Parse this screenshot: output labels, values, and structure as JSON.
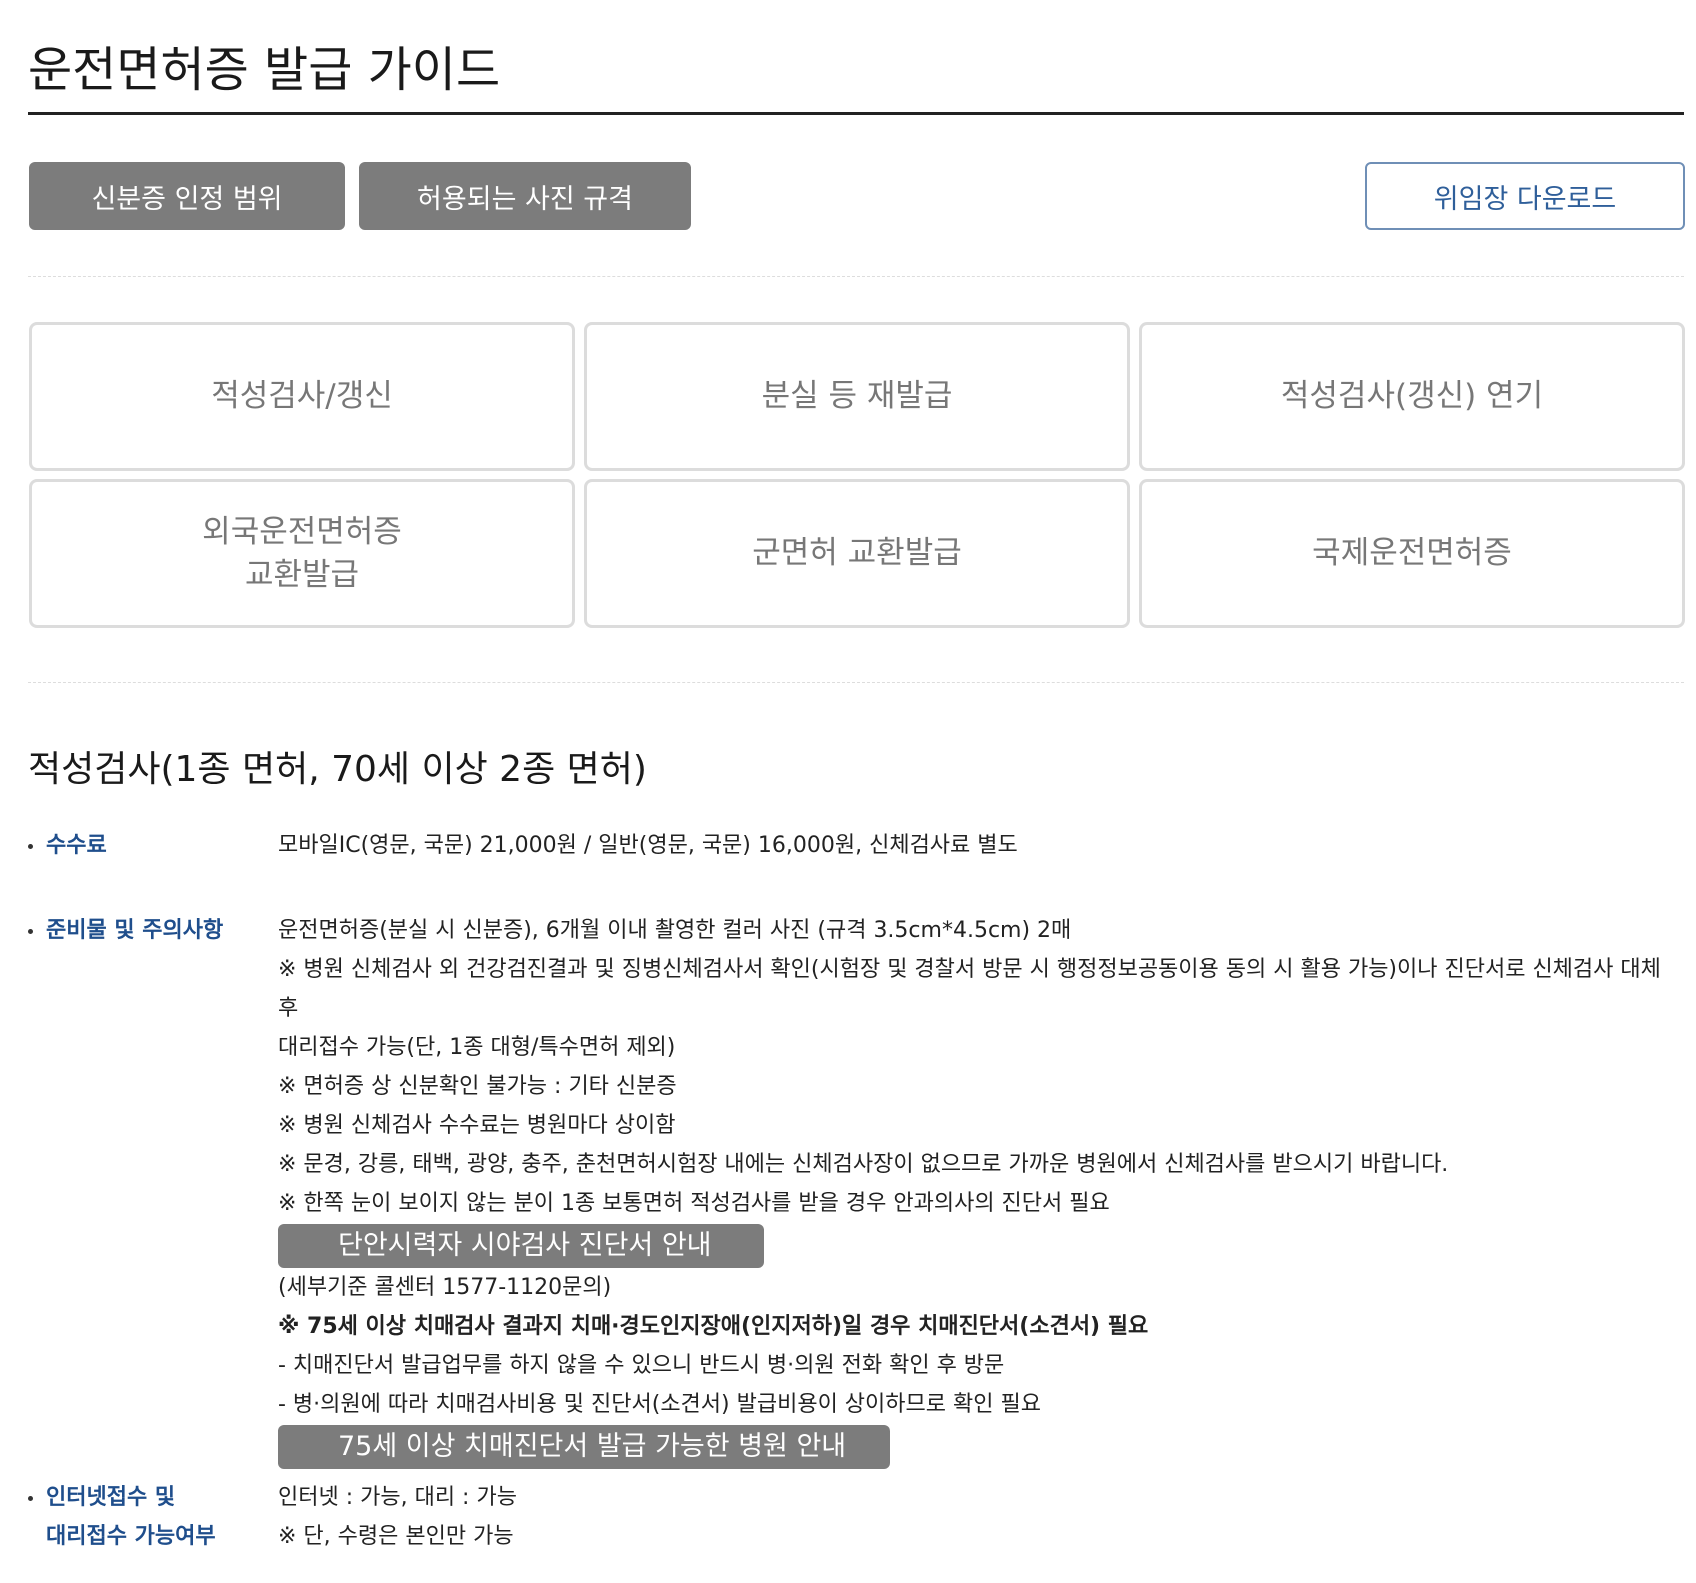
{
  "page_title": "운전면허증 발급 가이드",
  "top_buttons": {
    "id_scope": "신분증 인정 범위",
    "photo_spec": "허용되는 사진 규격",
    "proxy_download": "위임장 다운로드"
  },
  "tiles": [
    "적성검사/갱신",
    "분실 등 재발급",
    "적성검사(갱신) 연기",
    "외국운전면허증\n교환발급",
    "군면허 교환발급",
    "국제운전면허증"
  ],
  "section_title": "적성검사(1종 면허, 70세 이상 2종 면허)",
  "fee": {
    "label": "수수료",
    "value": "모바일IC(영문, 국문) 21,000원 / 일반(영문, 국문) 16,000원, 신체검사료 별도"
  },
  "prep": {
    "label": "준비물 및 주의사항",
    "lines": [
      "운전면허증(분실 시 신분증), 6개월 이내 촬영한 컬러 사진 (규격 3.5cm*4.5cm) 2매",
      "※ 병원 신체검사 외 건강검진결과 및 징병신체검사서 확인(시험장 및 경찰서 방문 시 행정정보공동이용 동의 시 활용 가능)이나 진단서로 신체검사 대체 후",
      "대리접수 가능(단, 1종 대형/특수면허 제외)",
      "※ 면허증 상 신분확인 불가능 : 기타 신분증",
      "※ 병원 신체검사 수수료는 병원마다 상이함",
      "※ 문경, 강릉, 태백, 광양, 충주, 춘천면허시험장 내에는 신체검사장이 없으므로 가까운 병원에서 신체검사를 받으시기 바랍니다.",
      "※ 한쪽 눈이 보이지 않는 분이 1종 보통면허 적성검사를 받을 경우 안과의사의 진단서 필요"
    ],
    "monocular_button": "단안시력자 시야검사 진단서 안내",
    "callcenter": "(세부기준 콜센터 1577-1120문의)",
    "dementia_notice": "※ 75세 이상 치매검사 결과지 치매·경도인지장애(인지저하)일 경우 치매진단서(소견서) 필요",
    "dementia_lines": [
      "- 치매진단서 발급업무를 하지 않을 수 있으니 반드시 병·의원 전화 확인 후 방문",
      "- 병·의원에 따라 치매검사비용 및 진단서(소견서) 발급비용이 상이하므로 확인 필요"
    ],
    "dementia_button": "75세 이상 치매진단서 발급 가능한 병원 안내"
  },
  "internet": {
    "label_line1": "인터넷접수 및",
    "label_line2": "대리접수 가능여부",
    "line1": "인터넷 : 가능, 대리 : 가능",
    "line2": "※ 단, 수령은 본인만 가능"
  }
}
